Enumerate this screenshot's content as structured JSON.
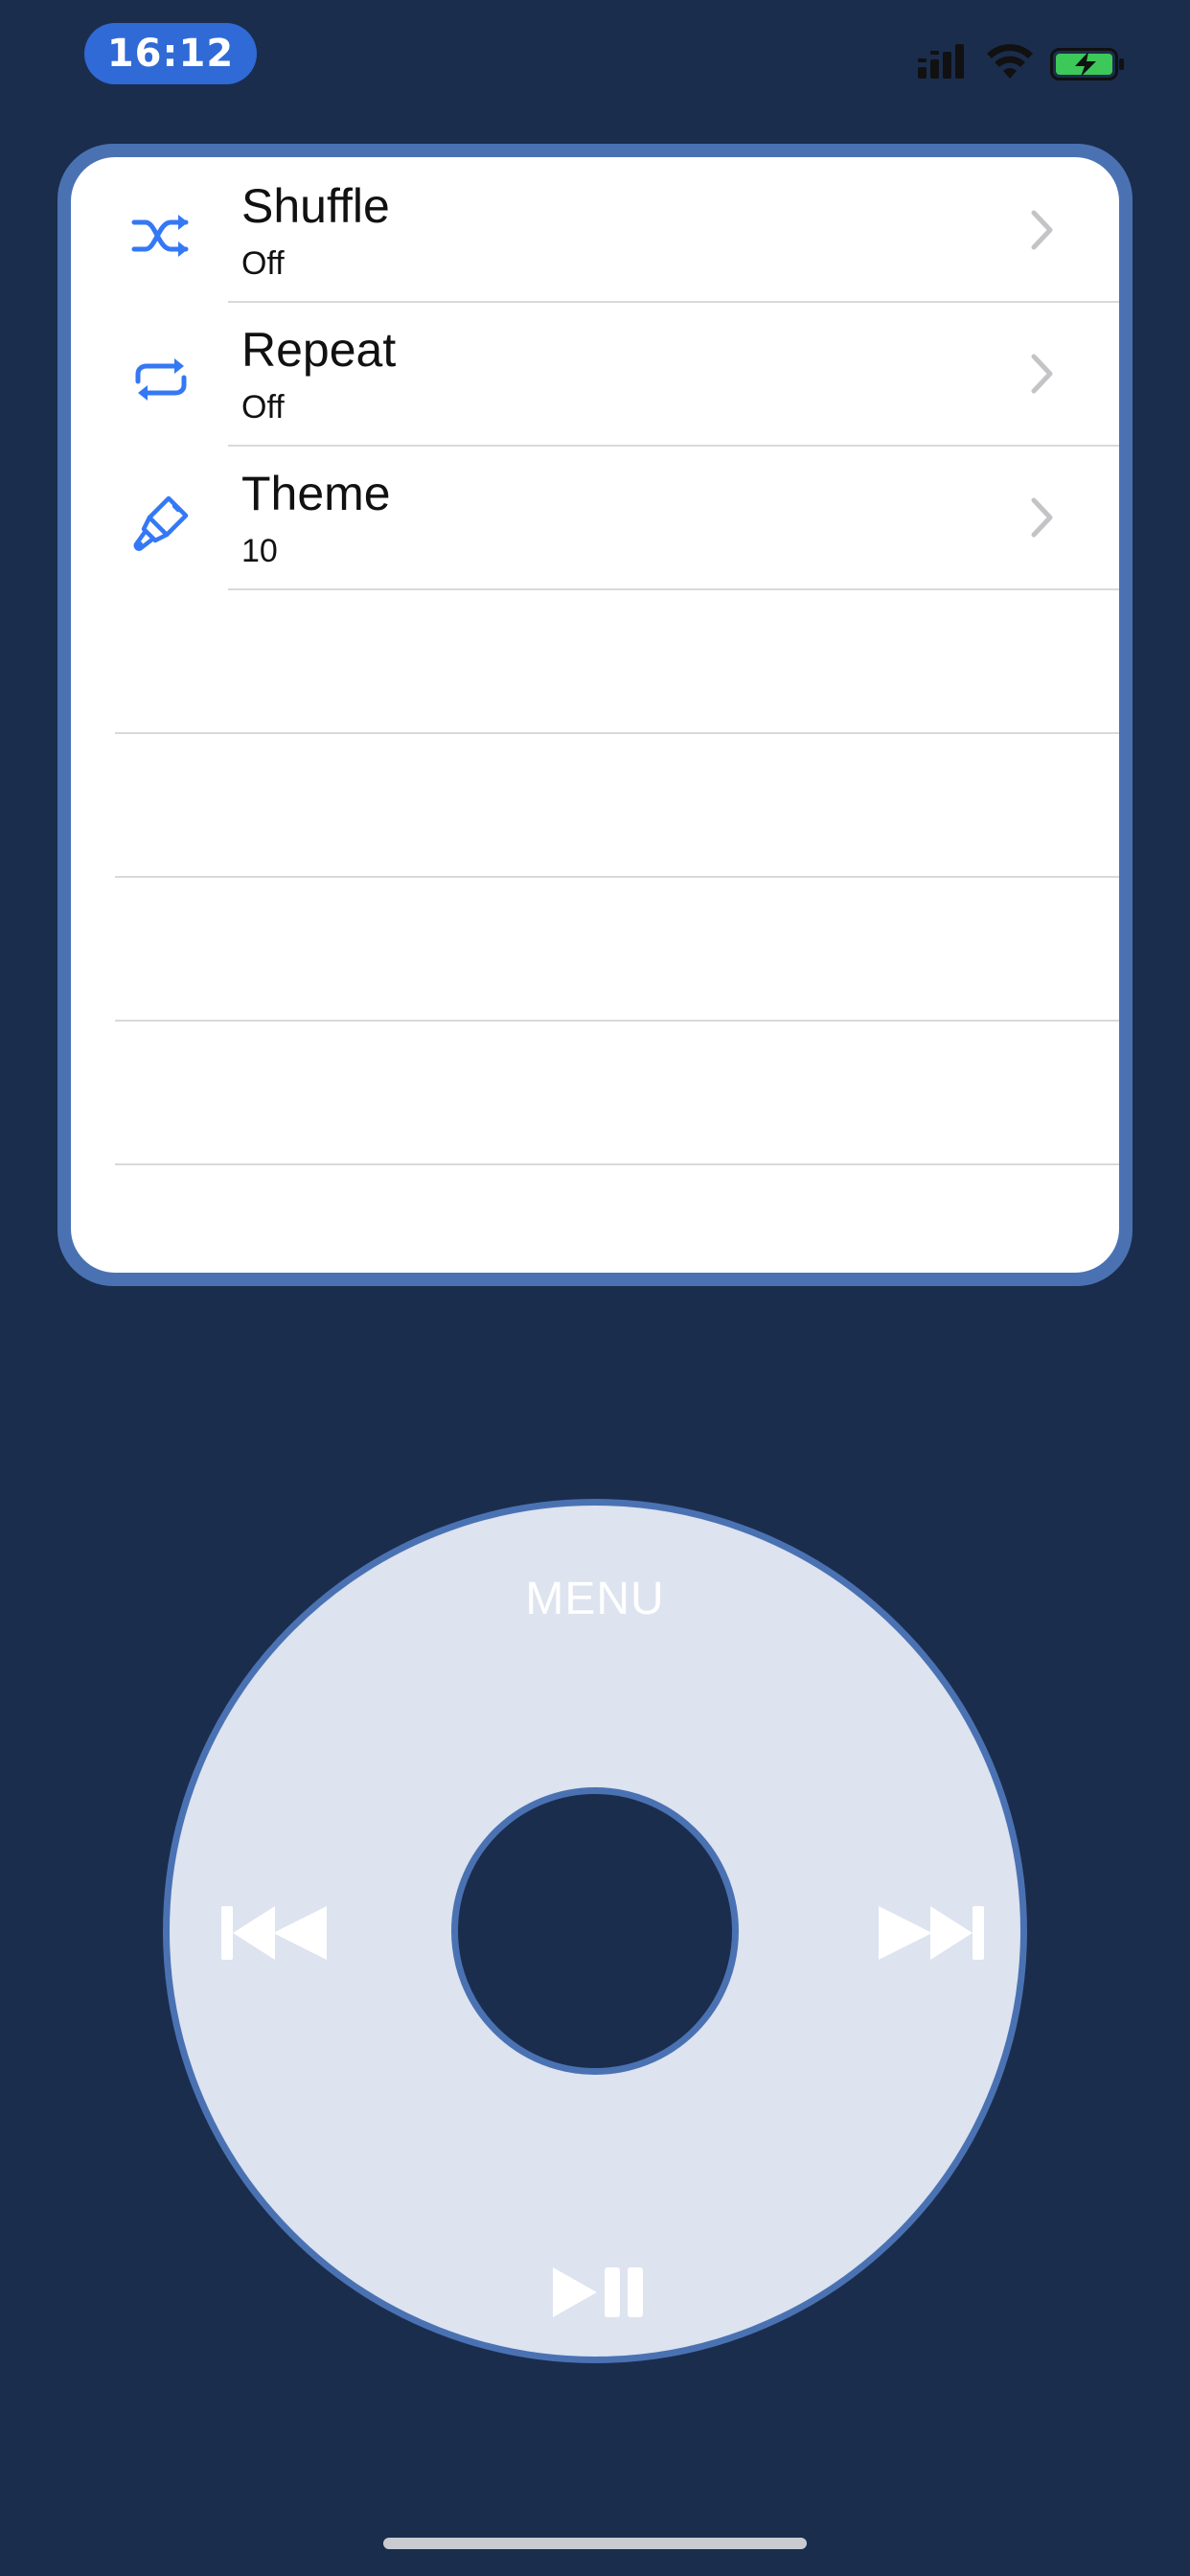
{
  "status_bar": {
    "time": "16:12",
    "icons": [
      "cellular-signal-icon",
      "wifi-icon",
      "battery-charging-icon"
    ]
  },
  "menu": {
    "items": [
      {
        "title": "Shuffle",
        "value": "Off",
        "icon": "shuffle-icon"
      },
      {
        "title": "Repeat",
        "value": "Off",
        "icon": "repeat-icon"
      },
      {
        "title": "Theme",
        "value": "10",
        "icon": "paintbrush-icon"
      }
    ],
    "empty_rows": 5
  },
  "wheel": {
    "menu_label": "MENU",
    "icons": [
      "previous-track-icon",
      "next-track-icon",
      "play-pause-icon"
    ]
  },
  "colors": {
    "background": "#1b2d4d",
    "accent": "#2f6ad6",
    "frame": "#4a72b3",
    "wheel": "#dde3ef",
    "icon_blue": "#3478f6"
  }
}
